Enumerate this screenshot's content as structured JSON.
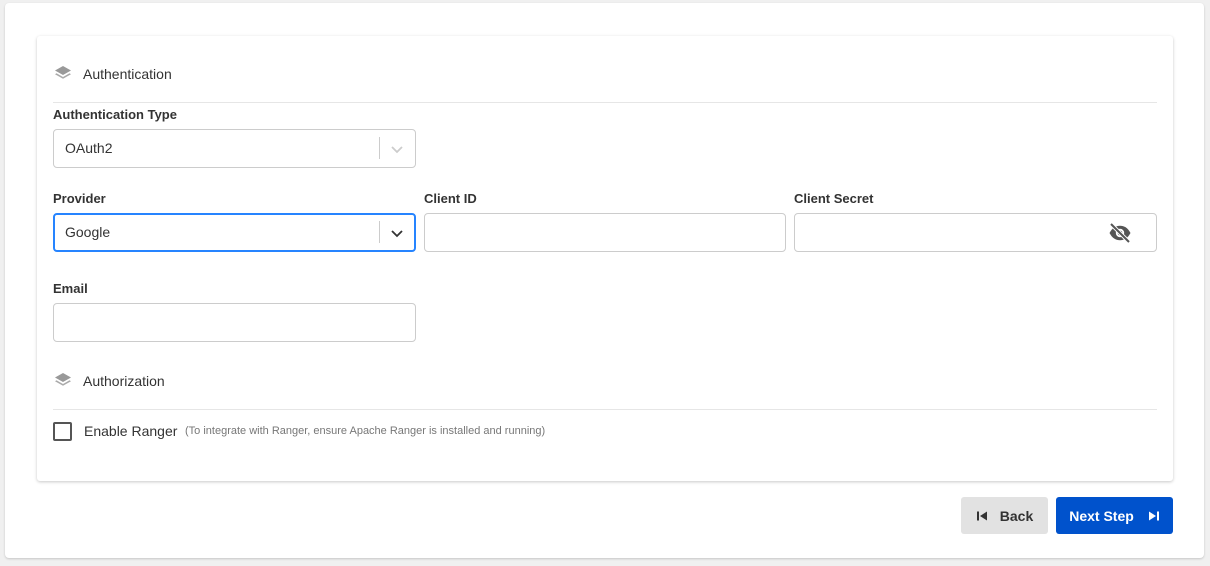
{
  "authentication": {
    "title": "Authentication",
    "icon": "layers-icon",
    "type_label": "Authentication Type",
    "type_value": "OAuth2",
    "provider_label": "Provider",
    "provider_value": "Google",
    "client_id_label": "Client ID",
    "client_id_value": "",
    "client_secret_label": "Client Secret",
    "client_secret_value": "",
    "email_label": "Email",
    "email_value": ""
  },
  "authorization": {
    "title": "Authorization",
    "icon": "layers-icon",
    "enable_ranger_label": "Enable Ranger",
    "enable_ranger_hint": "(To integrate with Ranger, ensure Apache Ranger is installed and running)",
    "enable_ranger_checked": false
  },
  "buttons": {
    "back_label": "Back",
    "next_label": "Next Step"
  },
  "colors": {
    "primary": "#0052cc",
    "focus": "#2684ff",
    "secondary_button": "#e2e2e2"
  }
}
